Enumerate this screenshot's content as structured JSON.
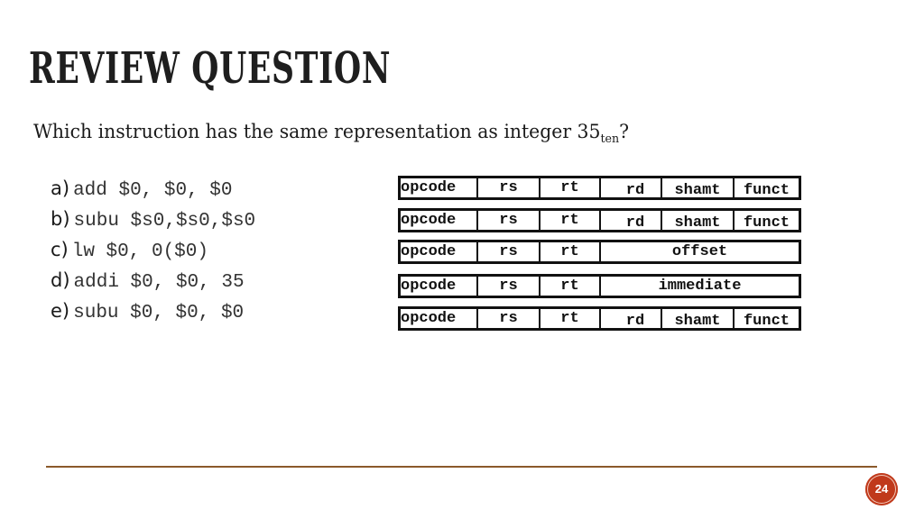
{
  "slide": {
    "title": "REVIEW QUESTION",
    "question": {
      "text": "Which instruction has the same representation as integer 35",
      "subscript": "ten",
      "suffix": "?"
    },
    "answers": [
      {
        "letter": "a)",
        "code": "add $0, $0, $0"
      },
      {
        "letter": "b)",
        "code": "subu $s0,$s0,$s0"
      },
      {
        "letter": "c)",
        "code": "lw $0, 0($0)"
      },
      {
        "letter": "d)",
        "code": "addi $0, $0, 35"
      },
      {
        "letter": "e)",
        "code": "subu $0, $0, $0"
      }
    ],
    "formats": [
      {
        "type": "R",
        "fields": [
          "opcode",
          "rs",
          "rt",
          "rd",
          "shamt",
          "funct"
        ]
      },
      {
        "type": "R",
        "fields": [
          "opcode",
          "rs",
          "rt",
          "rd",
          "shamt",
          "funct"
        ]
      },
      {
        "type": "I",
        "fields": [
          "opcode",
          "rs",
          "rt",
          "offset"
        ]
      },
      {
        "type": "I",
        "fields": [
          "opcode",
          "rs",
          "rt",
          "immediate"
        ]
      },
      {
        "type": "R",
        "fields": [
          "opcode",
          "rs",
          "rt",
          "rd",
          "shamt",
          "funct"
        ]
      }
    ],
    "page_number": "24",
    "colors": {
      "accent": "#c0391b",
      "footer_line": "#8b5a2b",
      "text": "#1a1a1a"
    }
  }
}
